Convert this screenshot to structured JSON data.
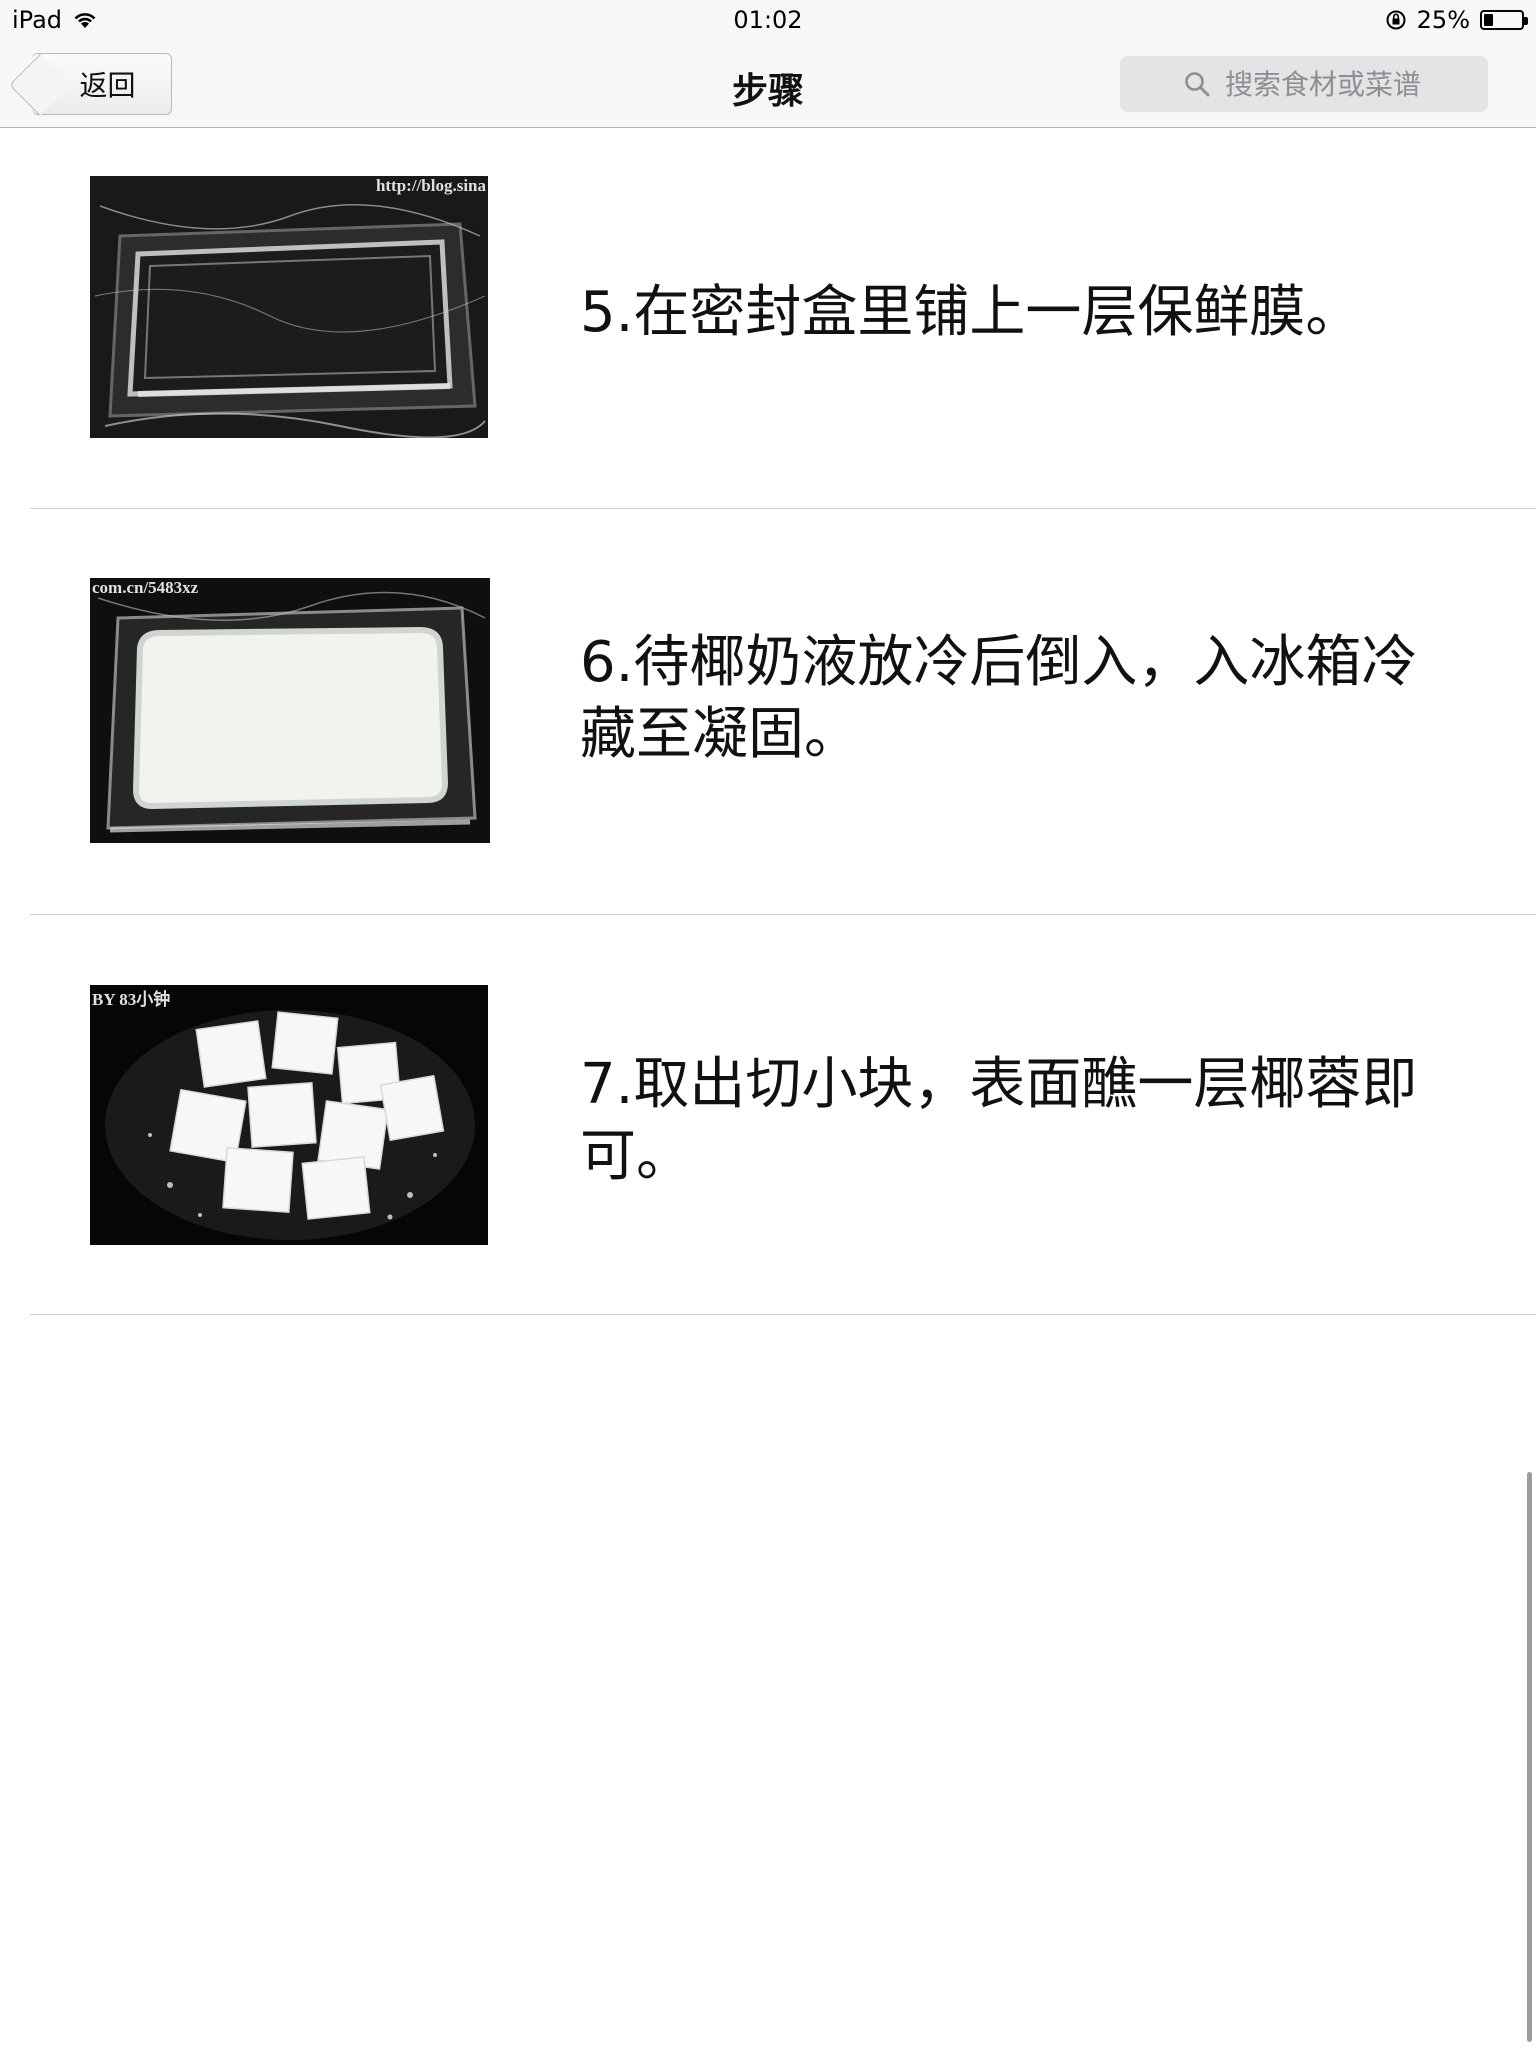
{
  "status_bar": {
    "device": "iPad",
    "time": "01:02",
    "battery_percent": "25%",
    "battery_level": 0.25
  },
  "nav": {
    "back_label": "返回",
    "title": "步骤",
    "search_placeholder": "搜索食材或菜谱"
  },
  "steps": [
    {
      "text": "5.在密封盒里铺上一层保鲜膜。",
      "image_watermark": "http://blog.sina"
    },
    {
      "text": "6.待椰奶液放冷后倒入，入冰箱冷藏至凝固。",
      "image_watermark": "com.cn/5483xz"
    },
    {
      "text": "7.取出切小块，表面醮一层椰蓉即可。",
      "image_watermark": "BY 83小钟"
    }
  ],
  "colors": {
    "bar_background": "#f7f7f7",
    "divider": "#cfcfcf",
    "search_field": "#e3e4e6"
  }
}
